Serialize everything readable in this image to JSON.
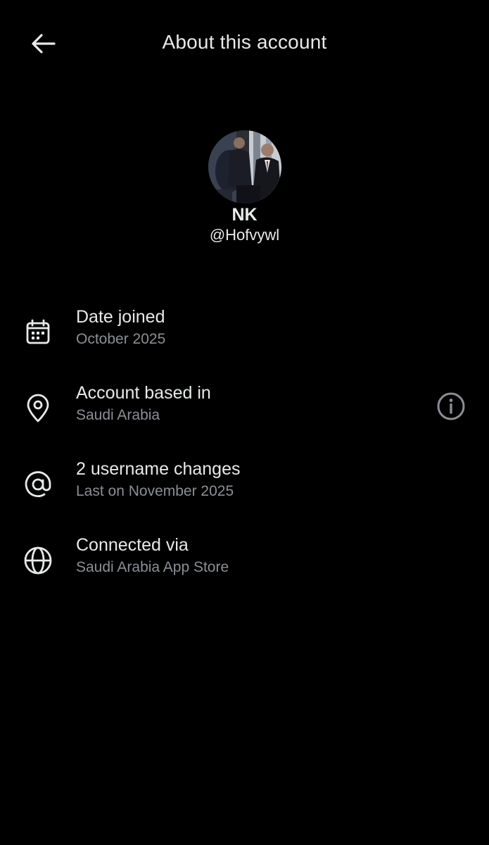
{
  "header": {
    "title": "About this account",
    "back_icon": "arrow-left-icon"
  },
  "profile": {
    "display_name": "NK",
    "handle": "@Hofvywl"
  },
  "rows": [
    {
      "icon": "calendar-icon",
      "title": "Date joined",
      "subtitle": "October 2025"
    },
    {
      "icon": "location-pin-icon",
      "title": "Account based in",
      "subtitle": "Saudi Arabia",
      "action_icon": "info-icon"
    },
    {
      "icon": "at-sign-icon",
      "title": "2 username changes",
      "subtitle": "Last on November 2025"
    },
    {
      "icon": "globe-icon",
      "title": "Connected via",
      "subtitle": "Saudi Arabia App Store"
    }
  ],
  "colors": {
    "background": "#000000",
    "primary_text": "#e7e9ea",
    "secondary_text": "#8b8f94"
  }
}
